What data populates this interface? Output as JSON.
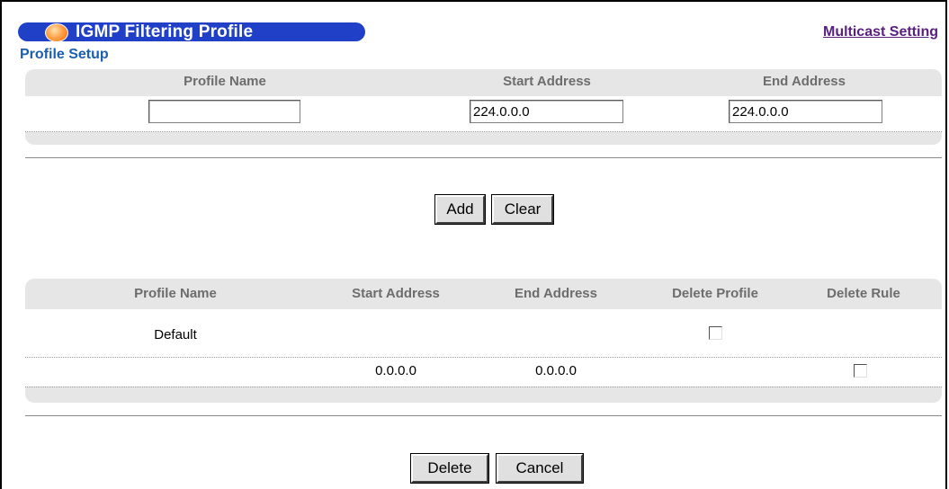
{
  "header": {
    "title": "IGMP Filtering Profile",
    "link": "Multicast Setting",
    "section": "Profile Setup"
  },
  "setup": {
    "columns": [
      "Profile Name",
      "Start Address",
      "End Address"
    ],
    "profile_name_value": "",
    "start_address_value": "224.0.0.0",
    "end_address_value": "224.0.0.0"
  },
  "actions": {
    "add": "Add",
    "clear": "Clear"
  },
  "table": {
    "columns": [
      "Profile Name",
      "Start Address",
      "End Address",
      "Delete Profile",
      "Delete Rule"
    ],
    "rows": [
      {
        "profile": "Default",
        "start": "",
        "end": "",
        "delete_profile": false,
        "delete_rule": null
      },
      {
        "profile": "",
        "start": "0.0.0.0",
        "end": "0.0.0.0",
        "delete_profile": null,
        "delete_rule": false
      }
    ]
  },
  "footer": {
    "delete": "Delete",
    "cancel": "Cancel"
  }
}
